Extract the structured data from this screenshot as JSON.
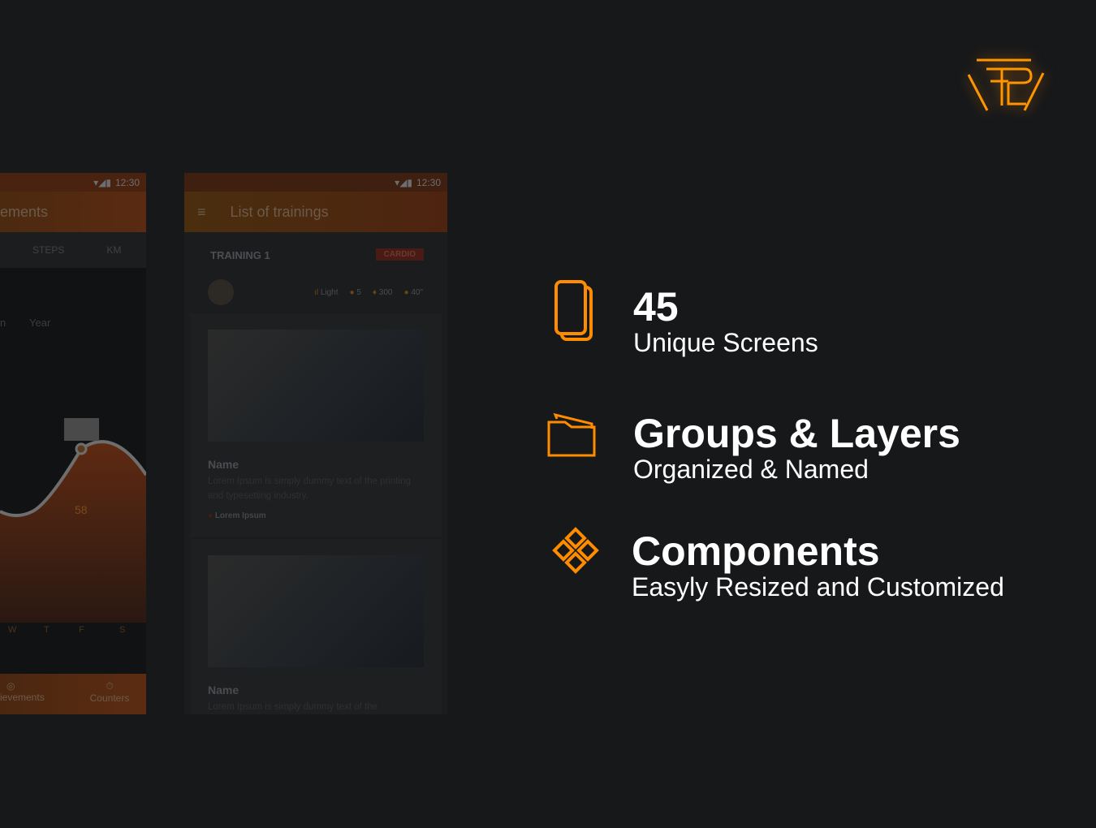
{
  "brand": {
    "logo_text": "FB",
    "accent": "#ff8c00"
  },
  "phone_achievements": {
    "time": "12:30",
    "title": "ements",
    "tabs": [
      "STEPS",
      "KM"
    ],
    "periods": [
      "n",
      "Year"
    ],
    "tooltip": "58",
    "days": [
      "W",
      "T",
      "F",
      "S"
    ],
    "nav": [
      "ievements",
      "Counters"
    ]
  },
  "phone_trainings": {
    "time": "12:30",
    "title": "List of trainings",
    "training_title": "TRAINING 1",
    "badge": "CARDIO",
    "stats": {
      "level": "Light",
      "sets": "5",
      "kcal": "300",
      "time": "40\""
    },
    "cards": [
      {
        "name": "Name",
        "desc": "Lorem Ipsum is simply dummy text of the printing and typesetting industry.",
        "tag": "Lorem Ipsum"
      },
      {
        "name": "Name",
        "desc": "Lorem Ipsum is simply dummy text of the"
      }
    ]
  },
  "features": [
    {
      "icon": "screens-icon",
      "title": "45",
      "subtitle": "Unique Screens"
    },
    {
      "icon": "folder-icon",
      "title": "Groups & Layers",
      "subtitle": "Organized & Named"
    },
    {
      "icon": "components-icon",
      "title": "Components",
      "subtitle": "Easyly Resized and Customized"
    }
  ]
}
